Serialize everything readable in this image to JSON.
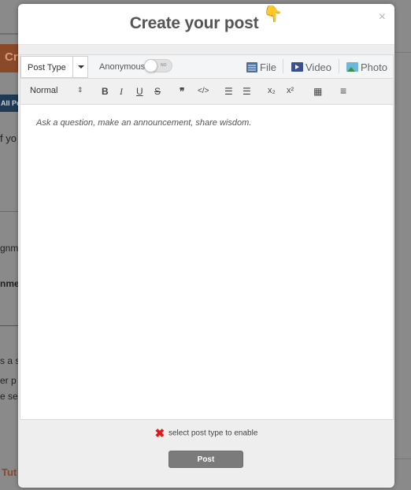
{
  "background": {
    "orange_button": "Cr",
    "all_posts_tab": "All Po",
    "text_fragments": [
      "f yo",
      "gnm",
      "nme",
      "s a s",
      "er p",
      "e se"
    ],
    "tutorial_link": "Tut"
  },
  "modal": {
    "title": "Create your post",
    "pointing_icon": "👇",
    "close_label": "×"
  },
  "options": {
    "post_type_label": "Post Type",
    "anonymous_label": "Anonymous",
    "toggle_state": "NO",
    "file_label": "File",
    "video_label": "Video",
    "photo_label": "Photo"
  },
  "toolbar": {
    "format_value": "Normal",
    "format_arrows": "⇕",
    "bold": "B",
    "italic": "I",
    "underline": "U",
    "strike": "S",
    "quote": "❞",
    "code": "</>",
    "ordered_list": "☰",
    "bullet_list": "☰",
    "subscript": "x₂",
    "superscript": "x²",
    "clear_format": "▦",
    "align": "≡"
  },
  "editor": {
    "placeholder": "Ask a question, make an announcement, share wisdom."
  },
  "footer": {
    "message": "select post type to enable",
    "x_icon": "✖",
    "post_button": "Post"
  }
}
